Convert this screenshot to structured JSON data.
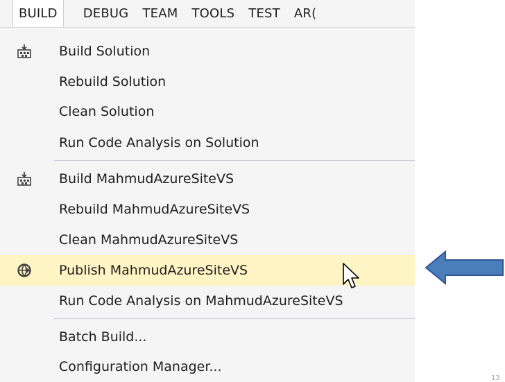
{
  "menubar": {
    "tabs": [
      "BUILD",
      "DEBUG",
      "TEAM",
      "TOOLS",
      "TEST",
      "AR("
    ]
  },
  "menu": {
    "items": [
      {
        "label": "Build Solution",
        "icon": "build-solution-icon"
      },
      {
        "label": "Rebuild Solution"
      },
      {
        "label": "Clean Solution"
      },
      {
        "label": "Run Code Analysis on Solution"
      },
      {
        "label": "Build MahmudAzureSiteVS",
        "icon": "build-project-icon"
      },
      {
        "label": "Rebuild MahmudAzureSiteVS"
      },
      {
        "label": "Clean MahmudAzureSiteVS"
      },
      {
        "label": "Publish MahmudAzureSiteVS",
        "icon": "publish-globe-icon"
      },
      {
        "label": "Run Code Analysis on MahmudAzureSiteVS"
      },
      {
        "label": "Batch Build..."
      },
      {
        "label": "Configuration Manager..."
      }
    ]
  },
  "colors": {
    "menu_bg": "#f5f5f5",
    "highlight_bg": "#fff4c4",
    "arrow_fill": "#4a7ebb",
    "arrow_stroke": "#2f5597"
  },
  "slide_number": "13"
}
